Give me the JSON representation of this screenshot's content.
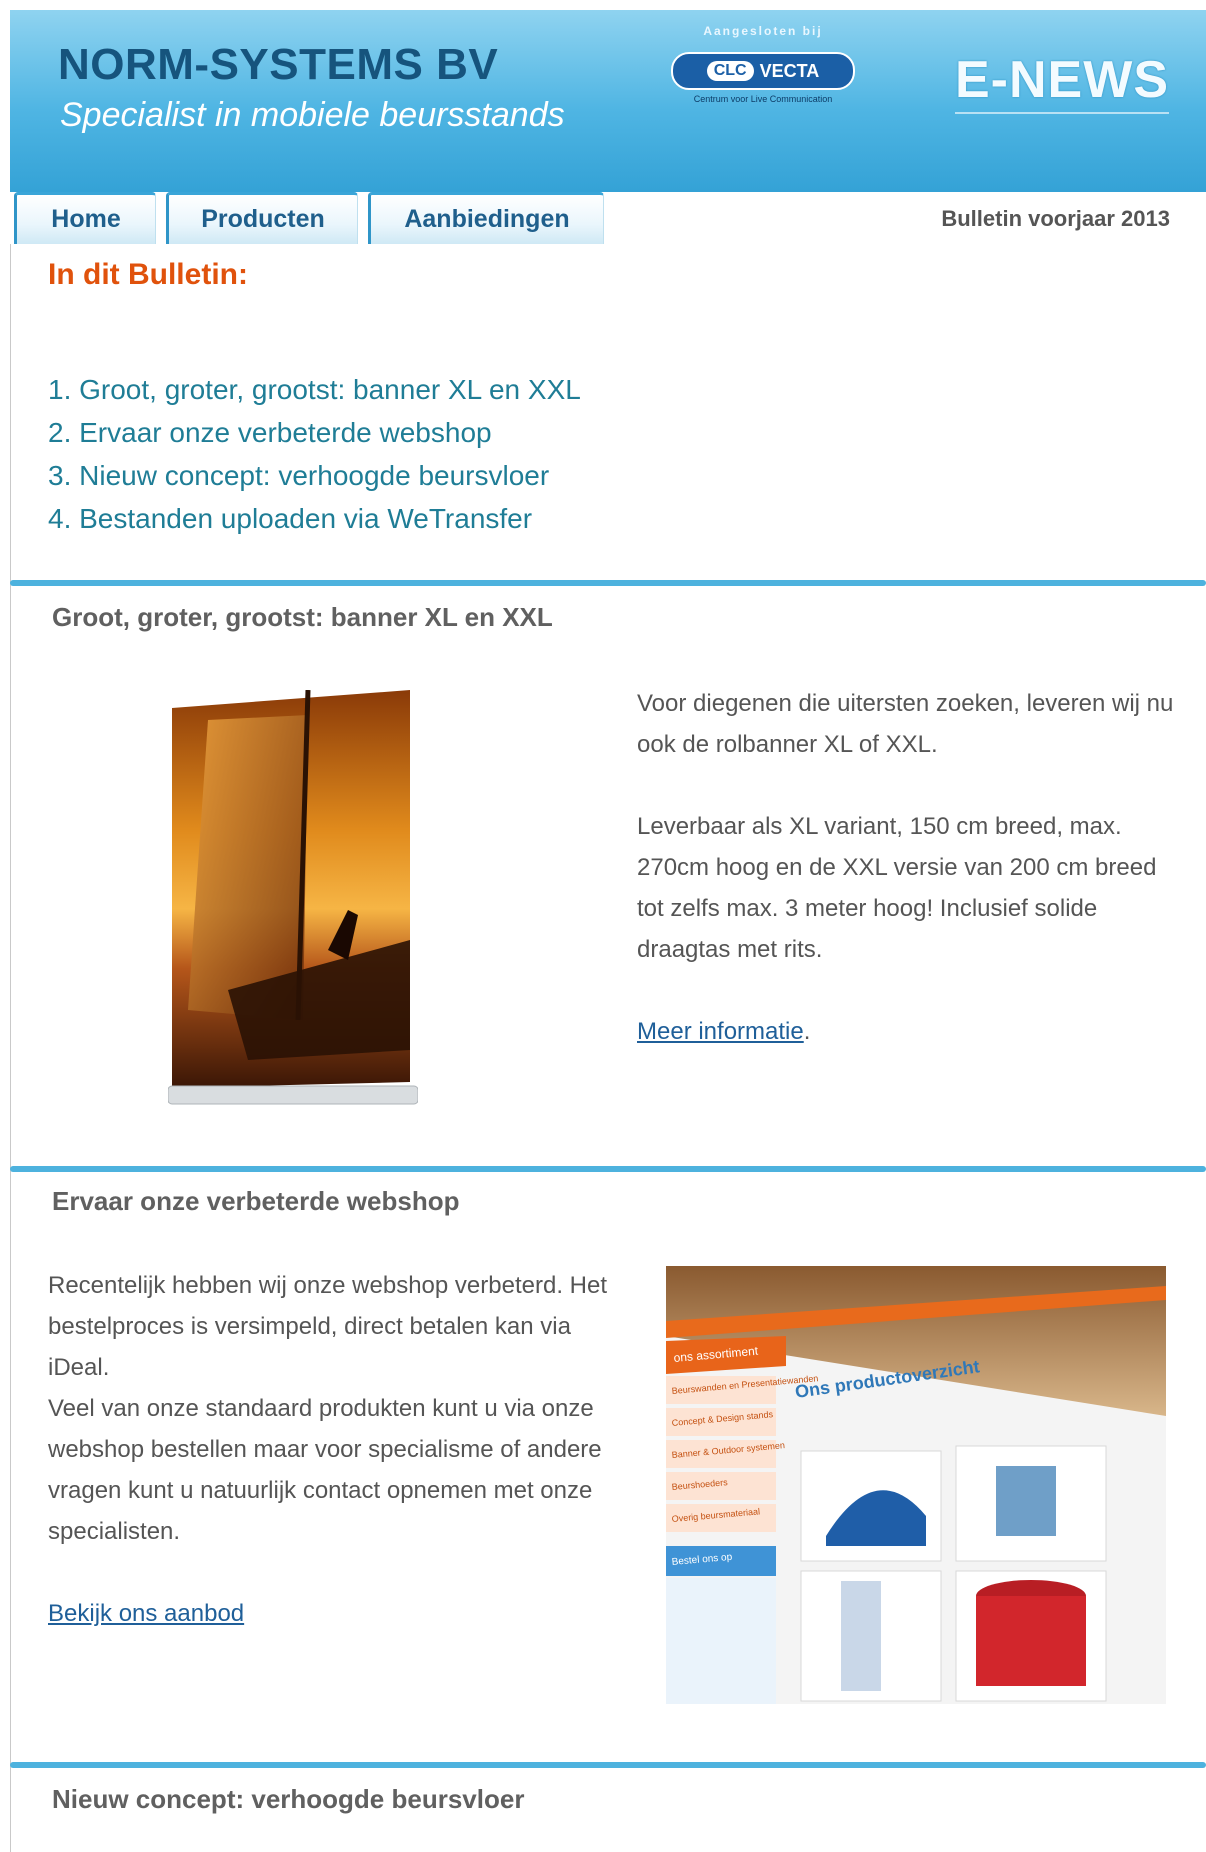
{
  "header": {
    "brand": "NORM-SYSTEMS BV",
    "tagline": "Specialist in mobiele beursstands",
    "association": {
      "caption": "Aangesloten bij",
      "logo_left": "CLC",
      "logo_right": "VECTA",
      "logo_sub": "Centrum voor Live Communication"
    },
    "enews": "E-NEWS"
  },
  "nav": {
    "tabs": [
      "Home",
      "Producten",
      "Aanbiedingen"
    ],
    "bulletin_label": "Bulletin voorjaar 2013"
  },
  "toc": {
    "title": "In dit Bulletin:",
    "items": [
      "1. Groot, groter, grootst: banner XL en XXL",
      "2. Ervaar onze verbeterde webshop",
      "3. Nieuw concept: verhoogde beursvloer",
      "4. Bestanden uploaden via WeTransfer"
    ]
  },
  "sections": [
    {
      "title": "Groot, groter, grootst: banner XL en XXL",
      "paragraphs": [
        "Voor diegenen die uitersten zoeken, leveren wij nu ook de rolbanner XL of XXL.",
        "Leverbaar als XL variant, 150 cm breed, max. 270cm hoog en de XXL versie van 200 cm breed tot zelfs max. 3 meter hoog! Inclusief solide draagtas met rits."
      ],
      "link_text": "Meer informatie",
      "link_suffix": "."
    },
    {
      "title": "Ervaar onze verbeterde webshop",
      "paragraphs": [
        "Recentelijk hebben wij onze webshop verbeterd. Het bestelproces is versimpeld, direct betalen kan via iDeal.",
        "Veel van onze standaard produkten kunt u via onze webshop bestellen maar voor specialisme of andere vragen kunt u natuurlijk contact  opnemen met onze specialisten."
      ],
      "link_text": "Bekijk ons aanbod",
      "screenshot": {
        "heading": "Ons productoverzicht",
        "menu_header": "ons assortiment",
        "menu_items": [
          "Beurswanden en Presentatiewanden",
          "Concept & Design stands",
          "Banner & Outdoor systemen",
          "Beurshoeders",
          "Overig beursmateriaal"
        ],
        "menu_blue": "Bestel ons op"
      }
    },
    {
      "title": "Nieuw concept: verhoogde beursvloer"
    }
  ],
  "colors": {
    "header_blue": "#4fb5e3",
    "brand_navy": "#16547d",
    "toc_orange": "#e0520c",
    "toc_teal": "#1f7d96",
    "divider": "#4db2de",
    "link": "#1f5f99"
  }
}
